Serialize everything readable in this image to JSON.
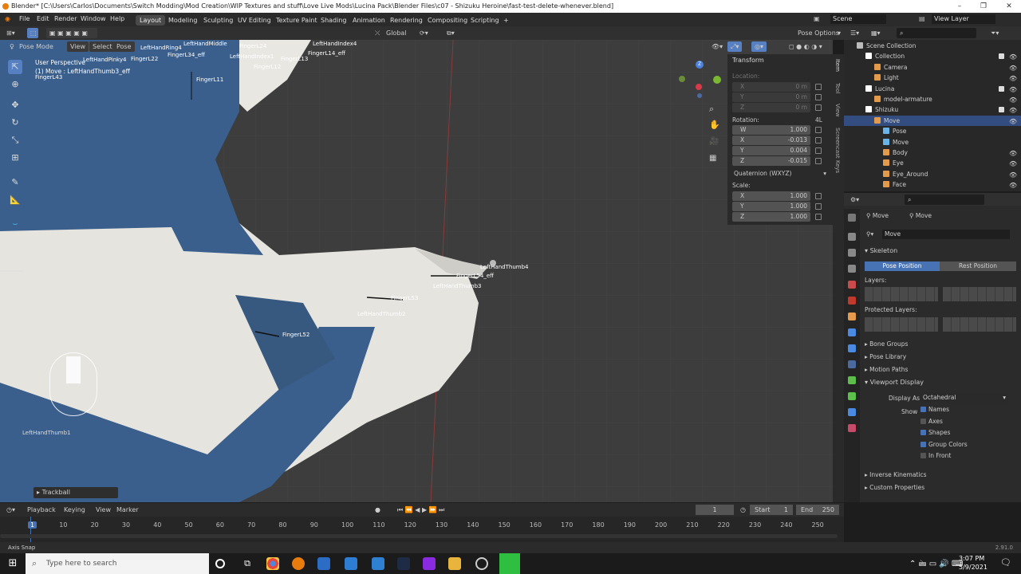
{
  "window": {
    "title": "Blender* [C:\\Users\\Carlos\\Documents\\Switch Modding\\Mod Creation\\WIP Textures and stuff\\Love Live Mods\\Lucina Pack\\Blender Files\\c07 - Shizuku Heroine\\fast-test-delete-whenever.blend]",
    "controls": [
      "–",
      "❐",
      "✕"
    ]
  },
  "menu": [
    "File",
    "Edit",
    "Render",
    "Window",
    "Help"
  ],
  "workspaces": [
    "Layout",
    "Modeling",
    "Sculpting",
    "UV Editing",
    "Texture Paint",
    "Shading",
    "Animation",
    "Rendering",
    "Compositing",
    "Scripting",
    "+"
  ],
  "active_workspace": "Layout",
  "scene_name": "Scene",
  "view_layer": "View Layer",
  "viewport_header": {
    "mode": "Pose Mode",
    "menus": [
      "View",
      "Select",
      "Pose"
    ],
    "orientation": "Global",
    "pose_options": "Pose Options"
  },
  "viewport": {
    "overlay_line1": "User Perspective",
    "overlay_line2": "(1) Move : LeftHandThumb3_eff",
    "last_op": "Trackball",
    "bones": [
      {
        "id": "b1",
        "label": "LeftHandThumb4"
      },
      {
        "id": "b2",
        "label": "FingerL54_eff"
      },
      {
        "id": "b3",
        "label": "LeftHandThumb3"
      },
      {
        "id": "b4",
        "label": "FingerL53"
      },
      {
        "id": "b5",
        "label": "LeftHandThumb2"
      },
      {
        "id": "b6",
        "label": "FingerL52"
      },
      {
        "id": "b7",
        "label": "LeftHandThumb1"
      },
      {
        "id": "b8",
        "label": "FingerL11"
      },
      {
        "id": "b9",
        "label": "FingerL24"
      },
      {
        "id": "b10",
        "label": "FingerL14_eff"
      },
      {
        "id": "b11",
        "label": "LeftHandIndex4"
      },
      {
        "id": "b12",
        "label": "LeftHandMiddle"
      },
      {
        "id": "b13",
        "label": "FingerL34_eff"
      },
      {
        "id": "b14",
        "label": "LeftHandRing4"
      },
      {
        "id": "b15",
        "label": "LeftHandPinky4"
      },
      {
        "id": "b16",
        "label": "FingerL43"
      },
      {
        "id": "b17",
        "label": "FingerL12"
      },
      {
        "id": "b18",
        "label": "FingerL13"
      },
      {
        "id": "b19",
        "label": "LeftHandIndex1"
      },
      {
        "id": "b20",
        "label": "FingerL22"
      }
    ]
  },
  "transform_panel": {
    "title": "Transform",
    "location_label": "Location:",
    "location": [
      {
        "k": "X",
        "v": "0 m"
      },
      {
        "k": "Y",
        "v": "0 m"
      },
      {
        "k": "Z",
        "v": "0 m"
      }
    ],
    "rotation_label": "Rotation:",
    "rotation_mode_tag": "4L",
    "rotation": [
      {
        "k": "W",
        "v": "1.000"
      },
      {
        "k": "X",
        "v": "-0.013"
      },
      {
        "k": "Y",
        "v": "0.004"
      },
      {
        "k": "Z",
        "v": "-0.015"
      }
    ],
    "rotation_mode": "Quaternion (WXYZ)",
    "scale_label": "Scale:",
    "scale": [
      {
        "k": "X",
        "v": "1.000"
      },
      {
        "k": "Y",
        "v": "1.000"
      },
      {
        "k": "Z",
        "v": "1.000"
      }
    ]
  },
  "side_tabs": [
    "Item",
    "Tool",
    "View",
    "Screencast Keys"
  ],
  "outliner": {
    "rows": [
      {
        "label": "Scene Collection",
        "indent": 0,
        "color": "#bbbbbb",
        "checkbox": false,
        "eye": false,
        "sel": false
      },
      {
        "label": "Collection",
        "indent": 1,
        "color": "#ffffff",
        "checkbox": true,
        "eye": true,
        "sel": false
      },
      {
        "label": "Camera",
        "indent": 2,
        "color": "#e39a4a",
        "checkbox": false,
        "eye": true,
        "sel": false
      },
      {
        "label": "Light",
        "indent": 2,
        "color": "#e39a4a",
        "checkbox": false,
        "eye": true,
        "sel": false
      },
      {
        "label": "Lucina",
        "indent": 1,
        "color": "#ffffff",
        "checkbox": true,
        "eye": true,
        "sel": false
      },
      {
        "label": "model-armature",
        "indent": 2,
        "color": "#e39a4a",
        "checkbox": false,
        "eye": true,
        "sel": false
      },
      {
        "label": "Shizuku",
        "indent": 1,
        "color": "#ffffff",
        "checkbox": true,
        "eye": true,
        "sel": false
      },
      {
        "label": "Move",
        "indent": 2,
        "color": "#e39a4a",
        "checkbox": false,
        "eye": true,
        "sel": true
      },
      {
        "label": "Pose",
        "indent": 3,
        "color": "#6ab3e8",
        "checkbox": false,
        "eye": false,
        "sel": false
      },
      {
        "label": "Move",
        "indent": 3,
        "color": "#6ab3e8",
        "checkbox": false,
        "eye": false,
        "sel": false
      },
      {
        "label": "Body",
        "indent": 3,
        "color": "#e39a4a",
        "checkbox": false,
        "eye": true,
        "sel": false
      },
      {
        "label": "Eye",
        "indent": 3,
        "color": "#e39a4a",
        "checkbox": false,
        "eye": true,
        "sel": false
      },
      {
        "label": "Eye_Around",
        "indent": 3,
        "color": "#e39a4a",
        "checkbox": false,
        "eye": true,
        "sel": false
      },
      {
        "label": "Face",
        "indent": 3,
        "color": "#e39a4a",
        "checkbox": false,
        "eye": true,
        "sel": false
      }
    ]
  },
  "properties": {
    "breadcrumb": [
      "Move",
      "Move"
    ],
    "data_name": "Move",
    "skeleton_title": "Skeleton",
    "pose_position": "Pose Position",
    "rest_position": "Rest Position",
    "layers_label": "Layers:",
    "protected_layers_label": "Protected Layers:",
    "sections": [
      "Bone Groups",
      "Pose Library",
      "Motion Paths"
    ],
    "viewport_display": "Viewport Display",
    "display_as_label": "Display As",
    "display_as": "Octahedral",
    "show_label": "Show",
    "show_options": [
      {
        "label": "Names",
        "on": true
      },
      {
        "label": "Axes",
        "on": false
      },
      {
        "label": "Shapes",
        "on": true
      },
      {
        "label": "Group Colors",
        "on": true
      },
      {
        "label": "In Front",
        "on": false
      }
    ],
    "sections2": [
      "Inverse Kinematics",
      "Custom Properties"
    ]
  },
  "timeline": {
    "menus": [
      "Playback",
      "Keying",
      "View",
      "Marker"
    ],
    "current_frame": "1",
    "start_label": "Start",
    "start": "1",
    "end_label": "End",
    "end": "250",
    "ticks": [
      "1",
      "10",
      "20",
      "30",
      "40",
      "50",
      "60",
      "70",
      "80",
      "90",
      "100",
      "110",
      "120",
      "130",
      "140",
      "150",
      "160",
      "170",
      "180",
      "190",
      "200",
      "210",
      "220",
      "230",
      "240",
      "250"
    ]
  },
  "status": {
    "left": "Axis Snap",
    "version": "2.91.0"
  },
  "taskbar": {
    "search_placeholder": "Type here to search",
    "time": "3:07 PM",
    "date": "5/9/2021"
  }
}
